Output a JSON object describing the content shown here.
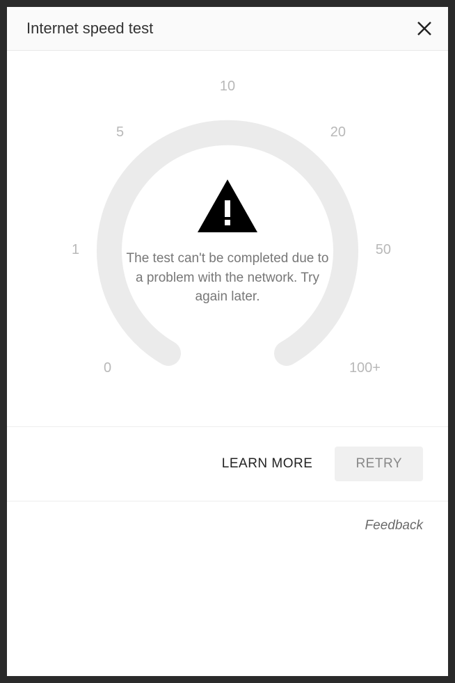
{
  "header": {
    "title": "Internet speed test"
  },
  "gauge": {
    "labels": {
      "tick_0": "0",
      "tick_1": "1",
      "tick_5": "5",
      "tick_10": "10",
      "tick_20": "20",
      "tick_50": "50",
      "tick_100": "100+"
    }
  },
  "error": {
    "message": "The test can't be completed due to a problem with the network. Try again later."
  },
  "actions": {
    "learn_more_label": "LEARN MORE",
    "retry_label": "RETRY"
  },
  "footer": {
    "feedback_label": "Feedback"
  }
}
